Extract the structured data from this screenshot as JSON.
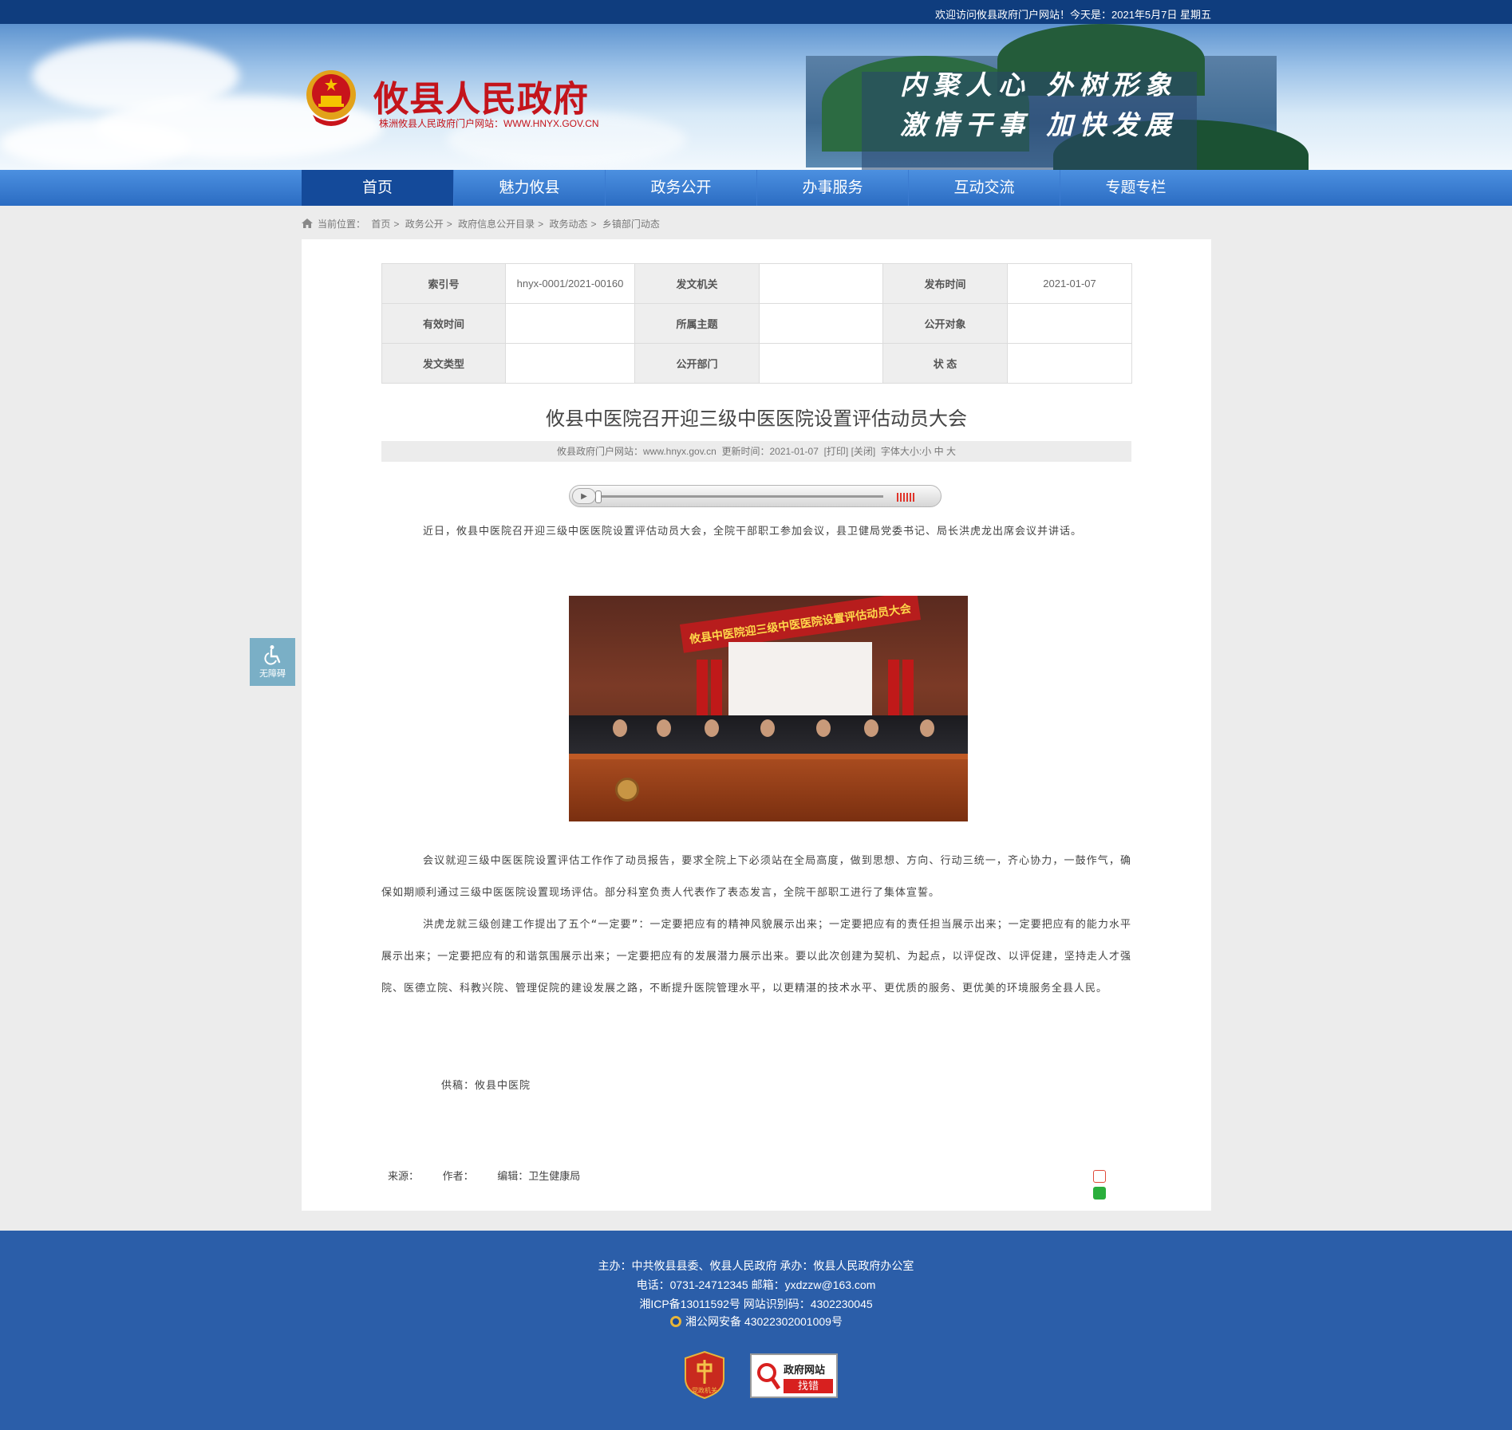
{
  "topbar": {
    "welcome": "欢迎访问攸县政府门户网站！今天是：2021年5月7日 星期五"
  },
  "header": {
    "site_title": "攸县人民政府",
    "site_subtitle": "株洲攸县人民政府门户网站：WWW.HNYX.GOV.CN",
    "slogan_line1": "内聚人心 外树形象",
    "slogan_line2": "激情干事 加快发展"
  },
  "nav": {
    "items": [
      "首页",
      "魅力攸县",
      "政务公开",
      "办事服务",
      "互动交流",
      "专题专栏"
    ],
    "active": "首页"
  },
  "breadcrumb": {
    "label": "当前位置：",
    "items": [
      "首页",
      "政务公开",
      "政府信息公开目录",
      "政务动态",
      "乡镇部门动态"
    ],
    "separator": ">"
  },
  "meta_table": {
    "rows": [
      [
        {
          "k": "索引号",
          "v": "hnyx-0001/2021-00160"
        },
        {
          "k": "发文机关",
          "v": ""
        },
        {
          "k": "发布时间",
          "v": "2021-01-07"
        }
      ],
      [
        {
          "k": "有效时间",
          "v": ""
        },
        {
          "k": "所属主题",
          "v": ""
        },
        {
          "k": "公开对象",
          "v": ""
        }
      ],
      [
        {
          "k": "发文类型",
          "v": ""
        },
        {
          "k": "公开部门",
          "v": ""
        },
        {
          "k": "状 态",
          "v": ""
        }
      ]
    ]
  },
  "article": {
    "title": "攸县中医院召开迎三级中医医院设置评估动员大会",
    "info": {
      "site": "攸县政府门户网站：www.hnyx.gov.cn",
      "updated": "更新时间：2021-01-07",
      "print": "[打印]",
      "close": "[关闭]",
      "font_size_label": "字体大小:",
      "font_small": "小",
      "font_medium": "中",
      "font_large": "大"
    },
    "paragraph1": "近日，攸县中医院召开迎三级中医医院设置评估动员大会，全院干部职工参加会议，县卫健局党委书记、局长洪虎龙出席会议并讲话。",
    "photo_banner_text": "攸县中医院迎三级中医医院设置评估动员大会",
    "paragraph2": "会议就迎三级中医医院设置评估工作作了动员报告，要求全院上下必须站在全局高度，做到思想、方向、行动三统一，齐心协力，一鼓作气，确保如期顺利通过三级中医医院设置现场评估。部分科室负责人代表作了表态发言，全院干部职工进行了集体宣誓。",
    "paragraph3": "洪虎龙就三级创建工作提出了五个“一定要”：一定要把应有的精神风貌展示出来；一定要把应有的责任担当展示出来；一定要把应有的能力水平展示出来；一定要把应有的和谐氛围展示出来；一定要把应有的发展潜力展示出来。要以此次创建为契机、为起点，以评促改、以评促建，坚持走人才强院、医德立院、科教兴院、管理促院的建设发展之路，不断提升医院管理水平，以更精湛的技术水平、更优质的服务、更优美的环境服务全县人民。",
    "supply": "供稿：攸县中医院",
    "source_label": "来源：",
    "author_label": "作者：",
    "editor_label": "编辑：",
    "editor": "卫生健康局"
  },
  "accessibility": {
    "label": "无障碍"
  },
  "footer": {
    "line1": "主办：中共攸县县委、攸县人民政府 承办：攸县人民政府办公室",
    "line2": "电话：0731-24712345 邮箱：yxdzzw@163.com",
    "line3": "湘ICP备13011592号    网站识别码：4302230045",
    "line4": "湘公网安备 43022302001009号",
    "badge1_label": "党政机关",
    "badge2_line1": "政府网站",
    "badge2_line2": "找错"
  },
  "colors": {
    "nav_blue": "#2b6cc2",
    "nav_active": "#144a9a",
    "title_red": "#c4141b",
    "footer_blue": "#2b5ea9"
  }
}
